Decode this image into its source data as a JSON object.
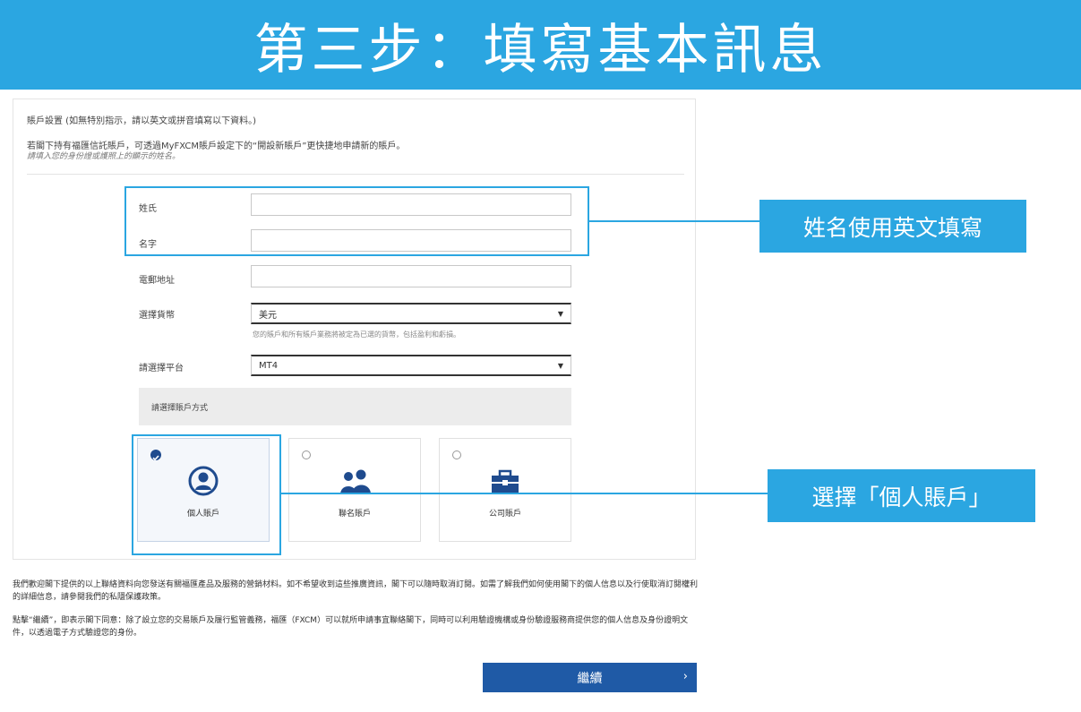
{
  "banner": {
    "title": "第三步：填寫基本訊息"
  },
  "form": {
    "section_title": "賬戶設置 (如無特別指示，請以英文或拼音填寫以下資料。)",
    "note_line1": "若閣下持有福匯信託賬戶，可透過MyFXCM賬戶設定下的“開設新賬戶”更快捷地申請新的賬戶。",
    "note_line2": "請填入您的身份證或護照上的顯示的姓名。",
    "fields": {
      "surname_label": "姓氏",
      "surname_value": "",
      "given_name_label": "名字",
      "given_name_value": "",
      "email_label": "電郵地址",
      "email_value": "",
      "currency_label": "選擇貨幣",
      "currency_value": "美元",
      "currency_helper": "您的賬戶和所有賬戶業務將被定為已選的貨幣，包括盈利和虧損。",
      "platform_label": "請選擇平台",
      "platform_value": "MT4"
    },
    "account_method": {
      "title": "請選擇賬戶方式",
      "options": [
        {
          "label": "個人賬戶",
          "selected": true,
          "icon": "person-icon"
        },
        {
          "label": "聯名賬戶",
          "selected": false,
          "icon": "people-icon"
        },
        {
          "label": "公司賬戶",
          "selected": false,
          "icon": "briefcase-icon"
        }
      ]
    }
  },
  "callouts": {
    "name_note": "姓名使用英文填寫",
    "account_note": "選擇「個人賬戶」"
  },
  "disclaimer": {
    "para1": "我們歡迎閣下提供的以上聯絡資料向您發送有關福匯產品及服務的營銷材料。如不希望收到這些推廣資訊，閣下可以隨時取消訂閱。如需了解我們如何使用閣下的個人信息以及行使取消訂閱權利的詳細信息，請參閱我們的私隱保護政策。",
    "para2": "點擊“繼續”，即表示閣下同意：除了設立您的交易賬戶及履行監管義務，福匯（FXCM）可以就所申請事宜聯絡閣下，同時可以利用驗證機構或身份驗證服務商提供您的個人信息及身份證明文件，以透過電子方式驗證您的身份。"
  },
  "actions": {
    "continue_label": "繼續",
    "continue_chevron": "›"
  },
  "colors": {
    "accent": "#2ba6e1",
    "button": "#1f5aa6"
  }
}
